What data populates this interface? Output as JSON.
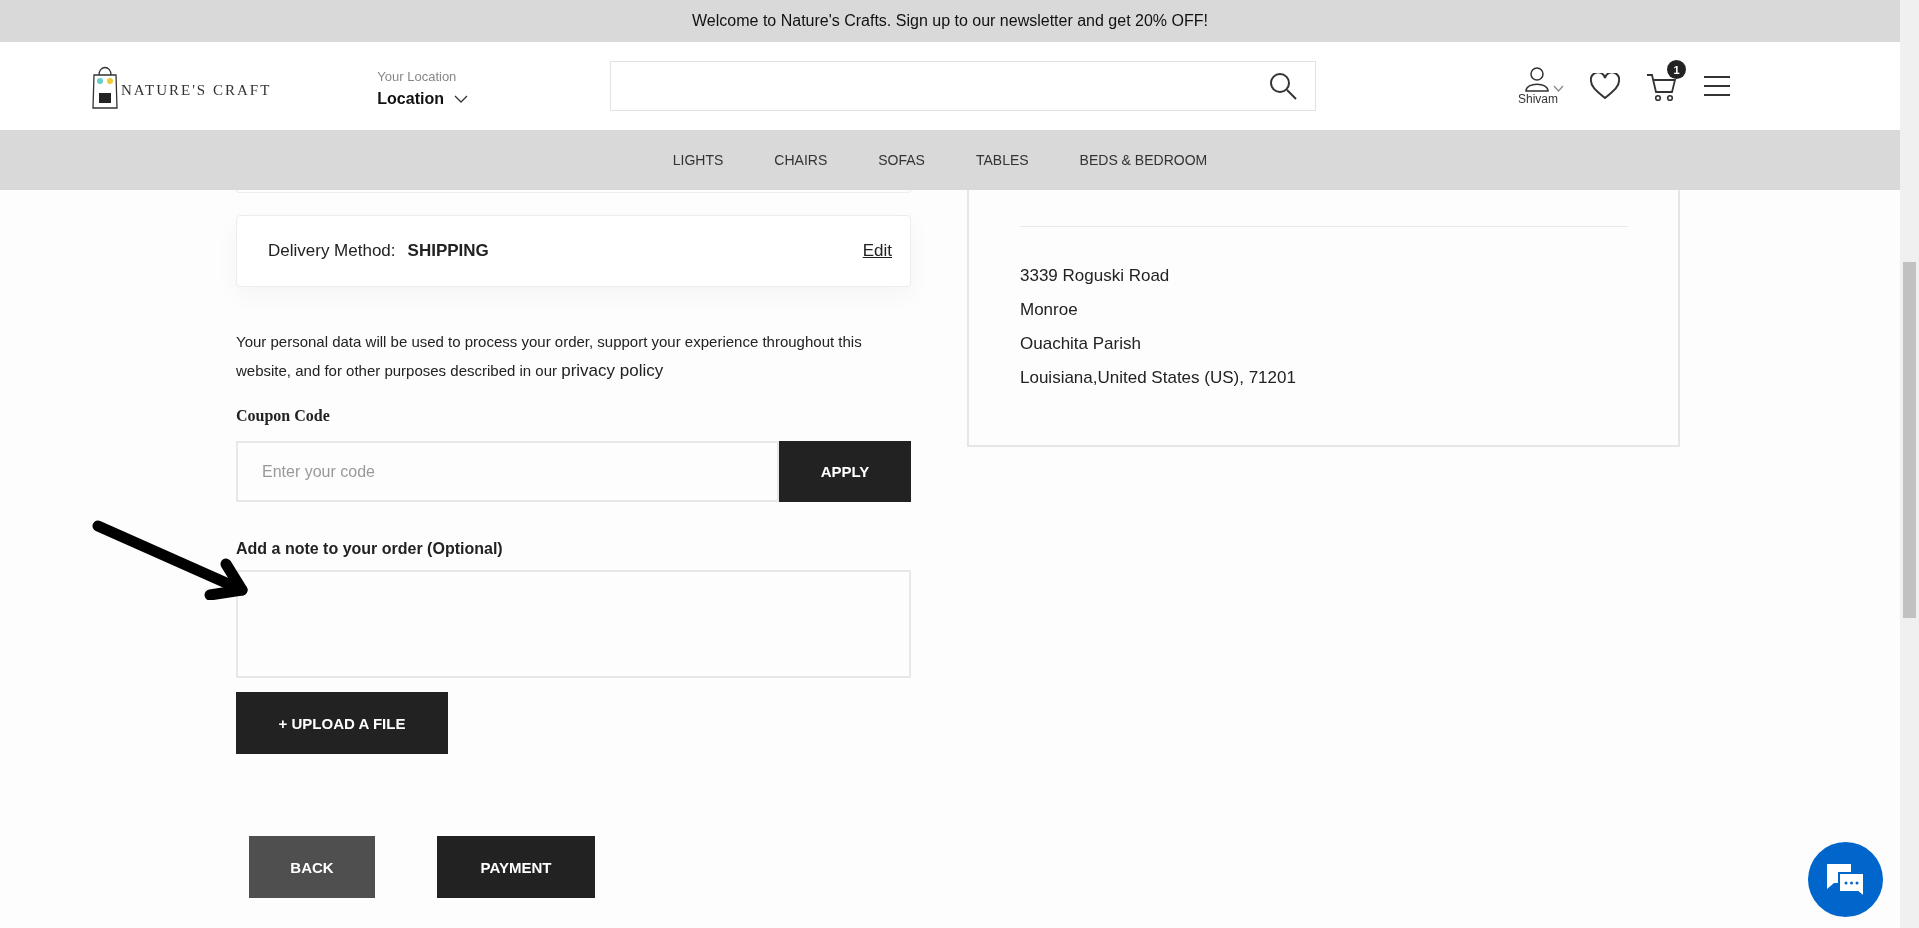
{
  "announcement": "Welcome to Nature's Crafts. Sign up to our newsletter and get 20% OFF!",
  "header": {
    "logo_text": "NATURE'S CRAFT",
    "location_label": "Your Location",
    "location_value": "Location",
    "user_name": "Shivam",
    "cart_count": "1"
  },
  "nav": [
    {
      "label": "LIGHTS"
    },
    {
      "label": "CHAIRS"
    },
    {
      "label": "SOFAS"
    },
    {
      "label": "TABLES"
    },
    {
      "label": "BEDS & BEDROOM"
    }
  ],
  "delivery": {
    "label": "Delivery Method:",
    "value": "SHIPPING",
    "edit": "Edit"
  },
  "privacy": {
    "text": "Your personal data will be used to process your order, support your experience throughout this website, and for other purposes described in our",
    "link": "privacy policy"
  },
  "coupon": {
    "label": "Coupon Code",
    "placeholder": "Enter your code",
    "button": "APPLY"
  },
  "note": {
    "label": "Add a note to your order (Optional)"
  },
  "upload_button": "+ UPLOAD A FILE",
  "actions": [
    {
      "label": "BACK",
      "kind": "secondary"
    },
    {
      "label": "PAYMENT",
      "kind": "primary"
    }
  ],
  "address": [
    "3339 Roguski Road",
    "Monroe",
    "Ouachita Parish",
    "Louisiana,United States (US), 71201"
  ]
}
